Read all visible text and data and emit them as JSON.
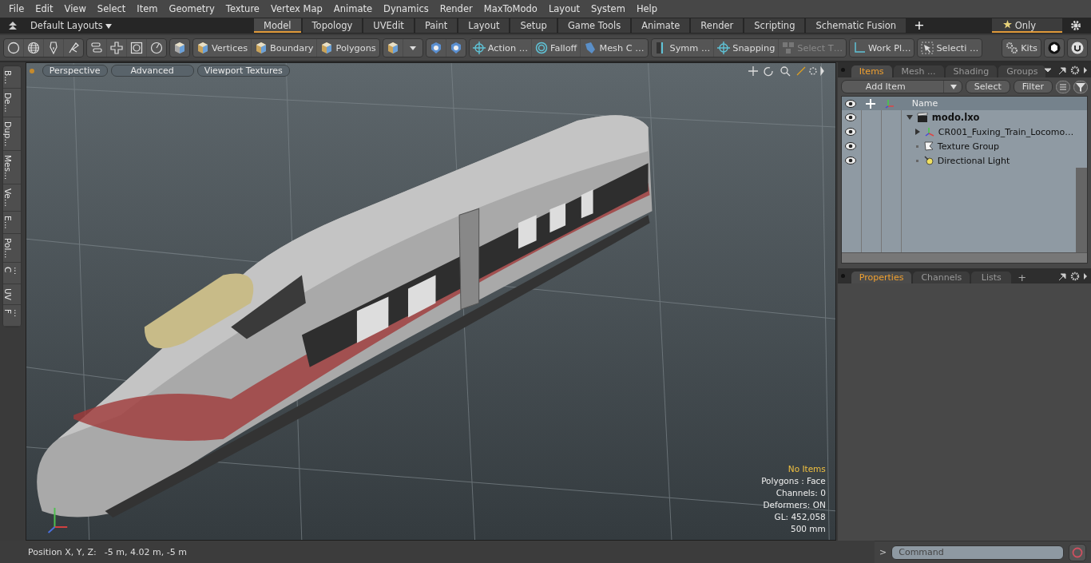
{
  "menu": [
    "File",
    "Edit",
    "View",
    "Select",
    "Item",
    "Geometry",
    "Texture",
    "Vertex Map",
    "Animate",
    "Dynamics",
    "Render",
    "MaxToModo",
    "Layout",
    "System",
    "Help"
  ],
  "layout_bar": {
    "layout_menu": "Default Layouts",
    "tabs": [
      {
        "label": "Model",
        "selected": true
      },
      {
        "label": "Topology",
        "selected": false
      },
      {
        "label": "UVEdit",
        "selected": false
      },
      {
        "label": "Paint",
        "selected": false
      },
      {
        "label": "Layout",
        "selected": false
      },
      {
        "label": "Setup",
        "selected": false
      },
      {
        "label": "Game Tools",
        "selected": false
      },
      {
        "label": "Animate",
        "selected": false
      },
      {
        "label": "Render",
        "selected": false
      },
      {
        "label": "Scripting",
        "selected": false
      },
      {
        "label": "Schematic Fusion",
        "selected": false
      }
    ],
    "add_tab": "+",
    "only_button": "Only"
  },
  "toolbar": {
    "buttons": [
      {
        "label": "Vertices",
        "disabled": false
      },
      {
        "label": "Boundary",
        "disabled": false
      },
      {
        "label": "Polygons",
        "disabled": false
      },
      {
        "label": "Action …",
        "disabled": false
      },
      {
        "label": "Falloff",
        "disabled": false
      },
      {
        "label": "Mesh C …",
        "disabled": false
      },
      {
        "label": "Symm …",
        "disabled": false
      },
      {
        "label": "Snapping",
        "disabled": false
      },
      {
        "label": "Select T…",
        "disabled": true
      },
      {
        "label": "Work Pl…",
        "disabled": false
      },
      {
        "label": "Selecti …",
        "disabled": false
      },
      {
        "label": "Kits",
        "disabled": false
      }
    ]
  },
  "side_tabs": [
    "B...",
    "De...",
    "Dup...",
    "Mes...",
    "Ve...",
    "E...",
    "Pol...",
    "C ...",
    "UV",
    "F ..."
  ],
  "viewport": {
    "buttons": [
      "Perspective",
      "Advanced",
      "Viewport Textures"
    ],
    "info": [
      {
        "text": "No Items",
        "kind": "highlight"
      },
      {
        "text": "Polygons : Face",
        "kind": "plain"
      },
      {
        "text": "Channels: 0",
        "kind": "plain"
      },
      {
        "text": "Deformers: ON",
        "kind": "plain"
      },
      {
        "text": "GL: 452,058",
        "kind": "plain"
      },
      {
        "text": "500 mm",
        "kind": "plain"
      }
    ]
  },
  "items_panel": {
    "tabs": [
      {
        "label": "Items",
        "selected": true
      },
      {
        "label": "Mesh ...",
        "selected": false
      },
      {
        "label": "Shading",
        "selected": false
      },
      {
        "label": "Groups",
        "selected": false
      }
    ],
    "add_item": "Add Item",
    "select": "Select",
    "filter": "Filter",
    "column": "Name",
    "tree": [
      {
        "name": "modo.lxo",
        "expanded": true,
        "children": [
          {
            "name": "CR001_Fuxing_Train_Locomo…",
            "expanded": false
          },
          {
            "name": "Texture Group"
          },
          {
            "name": "Directional Light"
          }
        ]
      }
    ]
  },
  "properties_panel": {
    "tabs": [
      {
        "label": "Properties",
        "selected": true
      },
      {
        "label": "Channels",
        "selected": false
      },
      {
        "label": "Lists",
        "selected": false
      }
    ],
    "add_tab": "+"
  },
  "status_bar": {
    "label": "Position X, Y, Z:",
    "value": "-5 m, 4.02 m, -5 m"
  },
  "command": {
    "prompt": ">",
    "placeholder": "Command"
  }
}
